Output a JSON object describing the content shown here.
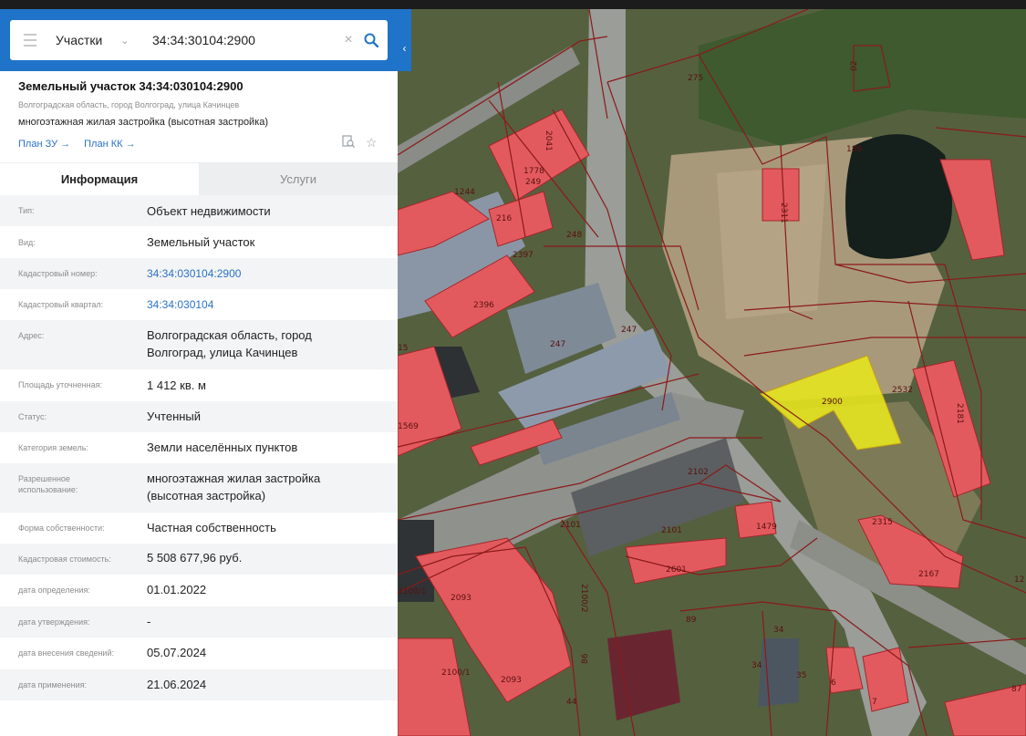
{
  "search": {
    "layer_value": "Участки",
    "query": "34:34:30104:2900"
  },
  "icons": {
    "menu": "hamburger-icon",
    "chevron": "chevron-down-icon",
    "clear": "close-icon",
    "search": "search-icon",
    "collapse": "chevron-left-icon",
    "pdf": "document-search-icon",
    "favorite": "star-icon"
  },
  "header": {
    "title": "Земельный участок 34:34:030104:2900",
    "address": "Волгоградская область, город Волгоград, улица Качинцев",
    "use": "многоэтажная жилая застройка (высотная застройка)",
    "link_zu": "План ЗУ →",
    "link_kk": "План КК →"
  },
  "tabs": {
    "info": "Информация",
    "services": "Услуги"
  },
  "info": [
    {
      "label": "Тип:",
      "value": "Объект недвижимости"
    },
    {
      "label": "Вид:",
      "value": "Земельный участок"
    },
    {
      "label": "Кадастровый номер:",
      "value": "34:34:030104:2900"
    },
    {
      "label": "Кадастровый квартал:",
      "value": "34:34:030104"
    },
    {
      "label": "Адрес:",
      "value": "Волгоградская область, город Волгоград, улица Качинцев"
    },
    {
      "label": "Площадь уточненная:",
      "value": "1 412 кв. м"
    },
    {
      "label": "Статус:",
      "value": "Учтенный"
    },
    {
      "label": "Категория земель:",
      "value": "Земли населённых пунктов"
    },
    {
      "label": "Разрешенное использование:",
      "value": "многоэтажная жилая застройка (высотная застройка)"
    },
    {
      "label": "Форма собственности:",
      "value": "Частная собственность"
    },
    {
      "label": "Кадастровая стоимость:",
      "value": "5 508 677,96 руб."
    },
    {
      "label": "дата определения:",
      "value": "01.01.2022"
    },
    {
      "label": "дата утверждения:",
      "value": "-"
    },
    {
      "label": "дата внесения сведений:",
      "value": "05.07.2024"
    },
    {
      "label": "дата применения:",
      "value": "21.06.2024"
    }
  ],
  "map": {
    "selected_parcel": "2900",
    "labels": [
      "275",
      "02",
      "189",
      "2311",
      "2041",
      "1778",
      "249",
      "1244",
      "216",
      "248",
      "2397",
      "2396",
      "247",
      "247",
      "15",
      "1569",
      "2532",
      "2181",
      "2102",
      "1479",
      "2101",
      "2101",
      "2315",
      "2167",
      "2601",
      "2100/1",
      "2093",
      "2100/2",
      "2100/1",
      "2093",
      "86",
      "89",
      "34",
      "34",
      "35",
      "6",
      "7",
      "87",
      "44",
      "12"
    ]
  },
  "colors": {
    "accent": "#1f73c8",
    "link": "#2a72c6",
    "building": "#e35a5e",
    "selected_parcel": "#e5e41f",
    "boundary": "#8b1a1a"
  }
}
